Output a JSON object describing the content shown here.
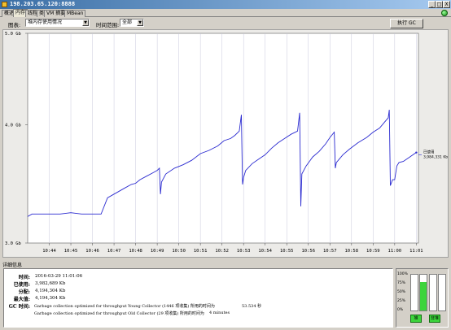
{
  "window": {
    "title": "198.203.65.120:8888",
    "minimize": "_",
    "maximize": "□",
    "close": "X"
  },
  "tabs": [
    "概述",
    "内存",
    "线程",
    "类",
    "VM 摘要",
    "MBean"
  ],
  "active_tab": 1,
  "toolbar": {
    "chart_label": "图表:",
    "chart_value": "堆内存使用情况",
    "time_label": "时间范围:",
    "time_value": "全部",
    "gc_button": "执行 GC"
  },
  "chart_data": {
    "type": "line",
    "title": "",
    "ylim": [
      3.0,
      5.0
    ],
    "y_scale": "log",
    "y_ticks": [
      {
        "v": 3.0,
        "label": "3.0 Gb"
      },
      {
        "v": 4.0,
        "label": "4.0 Gb"
      },
      {
        "v": 5.0,
        "label": "5.0 Gb"
      }
    ],
    "x_ticks": [
      "10:44",
      "10:45",
      "10:46",
      "10:47",
      "10:48",
      "10:49",
      "10:50",
      "10:51",
      "10:52",
      "10:53",
      "10:54",
      "10:55",
      "10:56",
      "10:57",
      "10:58",
      "10:59",
      "11:00",
      "11:01"
    ],
    "xlim": [
      0,
      18.1
    ],
    "series": [
      {
        "color": "#2a2ad0",
        "x": [
          0,
          0.2,
          0.5,
          1.0,
          1.5,
          2.0,
          2.5,
          3.0,
          3.4,
          3.7,
          4.0,
          4.2,
          4.5,
          4.8,
          5.0,
          5.2,
          5.5,
          5.8,
          6.0,
          6.1,
          6.15,
          6.2,
          6.4,
          6.8,
          7.2,
          7.6,
          8.0,
          8.4,
          8.8,
          9.1,
          9.4,
          9.6,
          9.8,
          9.9,
          9.95,
          10.0,
          10.1,
          10.4,
          10.7,
          11.0,
          11.3,
          11.6,
          11.9,
          12.2,
          12.5,
          12.6,
          12.65,
          12.7,
          12.9,
          13.2,
          13.5,
          13.8,
          14.0,
          14.2,
          14.25,
          14.3,
          14.6,
          14.9,
          15.3,
          15.7,
          16.0,
          16.3,
          16.5,
          16.7,
          16.75,
          16.8,
          16.9,
          17.0,
          17.1,
          17.2,
          17.4,
          17.7,
          18.0
        ],
        "y": [
          3.2,
          3.22,
          3.22,
          3.22,
          3.22,
          3.23,
          3.22,
          3.22,
          3.22,
          3.35,
          3.38,
          3.4,
          3.43,
          3.46,
          3.47,
          3.5,
          3.53,
          3.56,
          3.58,
          3.6,
          3.38,
          3.48,
          3.55,
          3.6,
          3.63,
          3.67,
          3.73,
          3.76,
          3.8,
          3.85,
          3.87,
          3.9,
          3.94,
          4.1,
          3.46,
          3.52,
          3.58,
          3.64,
          3.68,
          3.72,
          3.78,
          3.83,
          3.87,
          3.91,
          3.94,
          4.12,
          3.28,
          3.55,
          3.62,
          3.7,
          3.75,
          3.82,
          3.88,
          3.93,
          3.6,
          3.65,
          3.72,
          3.77,
          3.83,
          3.88,
          3.93,
          3.97,
          4.02,
          4.07,
          4.15,
          3.45,
          3.5,
          3.5,
          3.62,
          3.65,
          3.66,
          3.7,
          3.74
        ]
      }
    ],
    "callout": {
      "line1": "已使用",
      "line2": "3,984,331 Kb",
      "value": 3.72
    }
  },
  "details": {
    "title": "详细信息",
    "time_label": "时间:",
    "time_value": "2016-03-29 11:01:06",
    "used_label": "已使用:",
    "used_value": "3,982,689 Kb",
    "alloc_label": "分配:",
    "alloc_value": "4,194,304 Kb",
    "max_label": "最大值:",
    "max_value": "4,194,304 Kb",
    "gc_label": "GC 时间:",
    "gc_line1": "Garbage collection optimized for throughput Young Collector (1446 项收集) 所用的时间为",
    "gc_line1_value": "53.534 秒",
    "gc_line2": "Garbage collection optimized for throughput Old Collector (29 项收集) 所用的时间为",
    "gc_line2_value": "4 minutes"
  },
  "heap": {
    "ticks": [
      "100%",
      "75%",
      "50%",
      "25%",
      "0%"
    ],
    "bars": [
      {
        "fill": 0.0,
        "color": "gray"
      },
      {
        "fill": 0.8,
        "color": "green"
      },
      {
        "fill": 0.0,
        "color": "gray"
      },
      {
        "fill": 0.0,
        "color": "gray"
      }
    ],
    "btn1": "堆",
    "btn2": "非堆"
  }
}
